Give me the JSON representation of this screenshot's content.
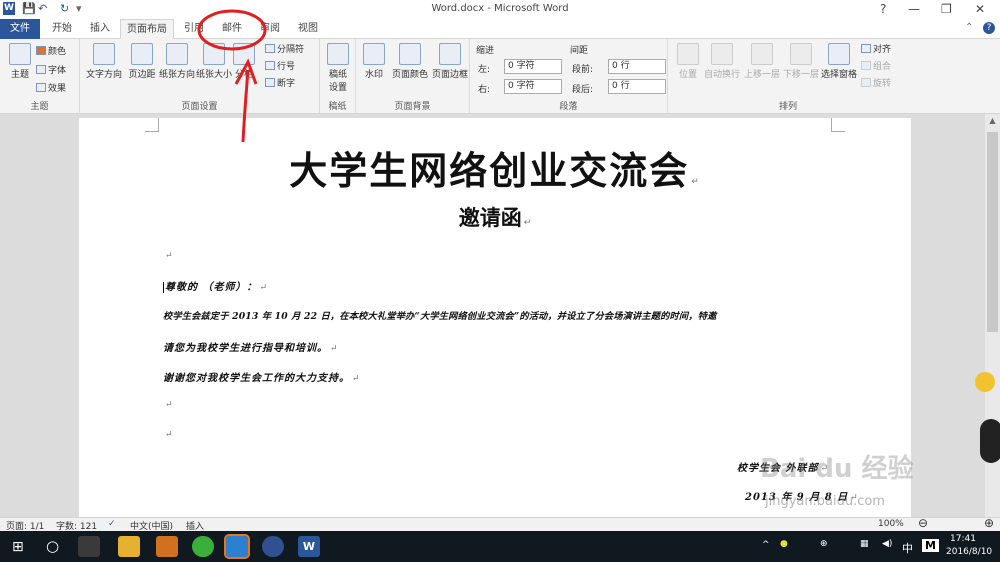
{
  "titlebar": {
    "app_icon": "W",
    "title": "Word.docx - Microsoft Word",
    "help": "?",
    "qa_save": "💾",
    "qa_undo": "↶",
    "qa_redo": "↻",
    "qa_more": "▾"
  },
  "tabs": [
    "文件",
    "开始",
    "插入",
    "页面布局",
    "引用",
    "邮件",
    "审阅",
    "视图"
  ],
  "ribbon": {
    "theme": {
      "themes": "主题",
      "colors": "颜色",
      "fonts": "字体",
      "effects": "效果",
      "group": "主题"
    },
    "page_setup": {
      "text_dir": "文字方向",
      "margins": "页边距",
      "orientation": "纸张方向",
      "size": "纸张大小",
      "columns": "分栏",
      "breaks": "分隔符",
      "line_numbers": "行号",
      "hyphenation": "断字",
      "group": "页面设置"
    },
    "draft": {
      "label1": "稿纸",
      "label2": "设置",
      "group": "稿纸"
    },
    "page_bg": {
      "watermark": "水印",
      "page_color": "页面颜色",
      "page_borders": "页面边框",
      "group": "页面背景"
    },
    "paragraph": {
      "indent": "缩进",
      "left": "左:",
      "left_val": "0 字符",
      "right": "右:",
      "right_val": "0 字符",
      "spacing": "间距",
      "before": "段前:",
      "before_val": "0 行",
      "after": "段后:",
      "after_val": "0 行",
      "group": "段落"
    },
    "arrange": {
      "position": "位置",
      "wrap": "自动换行",
      "forward": "上移一层",
      "backward": "下移一层",
      "pane": "选择窗格",
      "align": "对齐",
      "group_btn": "组合",
      "rotate": "旋转",
      "group": "排列"
    }
  },
  "document": {
    "title": "大学生网络创业交流会",
    "subtitle": "邀请函",
    "salutation": "尊敬的          （老师）：",
    "body1": "校学生会兹定于 2013 年 10 月 22 日，在本校大礼堂举办“大学生网络创业交流会”的活动，并设立了分会场演讲主题的时间，特邀",
    "body2": "请您为我校学生进行指导和培训。",
    "body3": "谢谢您对我校学生会工作的大力支持。",
    "sign": "校学生会 外联部",
    "date": "2013 年 9 月 8 日",
    "para_mark": "↵"
  },
  "statusbar": {
    "page": "页面: 1/1",
    "words": "字数: 121",
    "lang": "中文(中国)",
    "insert": "插入",
    "zoom": "100%"
  },
  "taskbar": {
    "time": "17:41",
    "date": "2016/8/10",
    "ime": "中",
    "ime2": "M"
  },
  "watermark": {
    "brand": "Bai du 经验",
    "url": "jingyan.baidu.com"
  },
  "colors": {
    "word_blue": "#2b579a",
    "annotation_red": "#e02020",
    "taskbar": "#101820"
  }
}
